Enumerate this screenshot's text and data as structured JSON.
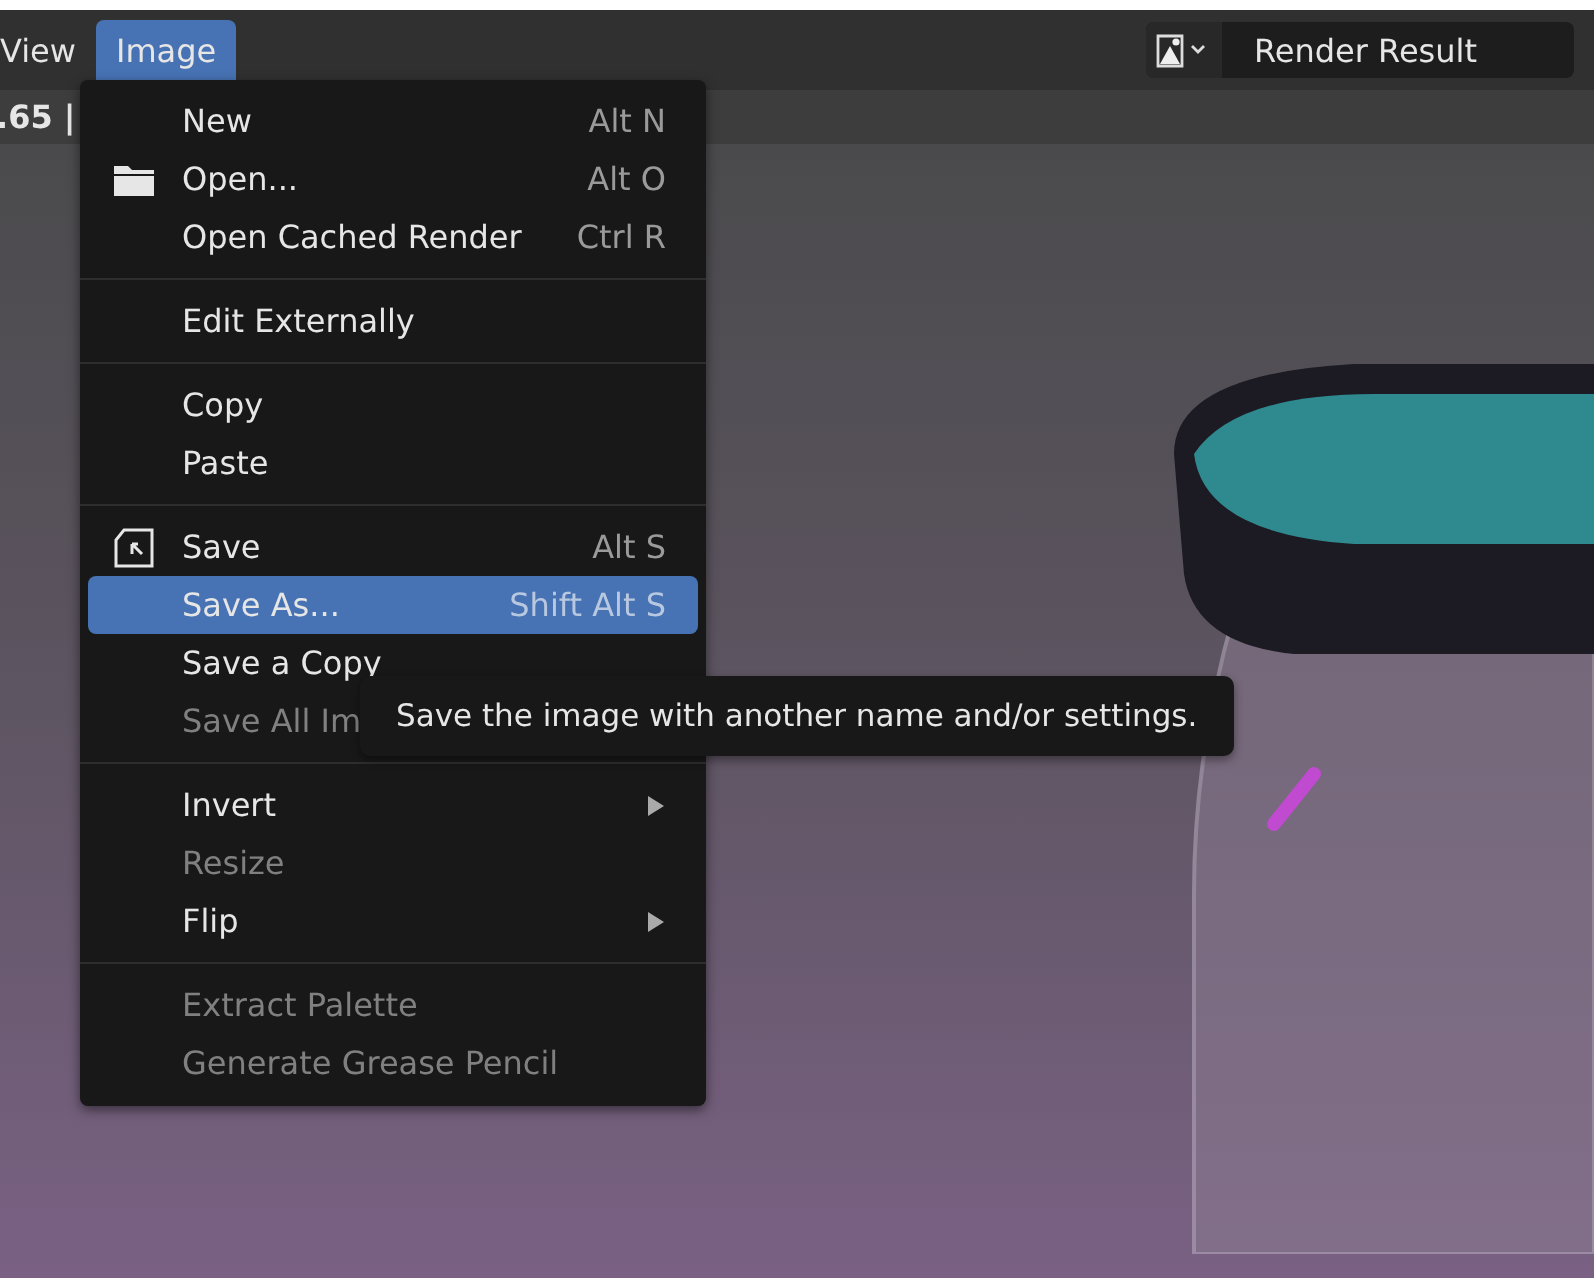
{
  "header": {
    "menus": [
      {
        "label": "View",
        "selected": false
      },
      {
        "label": "Image",
        "selected": true
      }
    ],
    "image_selector": {
      "label": "Render Result"
    }
  },
  "info_bar": {
    "text": ".65 |"
  },
  "image_menu": {
    "sections": [
      {
        "items": [
          {
            "label": "New",
            "shortcut": "Alt N",
            "kind": "plain",
            "disabled": false,
            "selected": false,
            "submenu": false
          },
          {
            "label": "Open...",
            "shortcut": "Alt O",
            "kind": "folder",
            "disabled": false,
            "selected": false,
            "submenu": false
          },
          {
            "label": "Open Cached Render",
            "shortcut": "Ctrl R",
            "kind": "plain",
            "disabled": false,
            "selected": false,
            "submenu": false
          }
        ]
      },
      {
        "items": [
          {
            "label": "Edit Externally",
            "kind": "plain",
            "disabled": false,
            "selected": false,
            "submenu": false
          }
        ]
      },
      {
        "items": [
          {
            "label": "Copy",
            "kind": "plain",
            "disabled": false,
            "selected": false,
            "submenu": false
          },
          {
            "label": "Paste",
            "kind": "plain",
            "disabled": false,
            "selected": false,
            "submenu": false
          }
        ]
      },
      {
        "items": [
          {
            "label": "Save",
            "shortcut": "Alt S",
            "kind": "save",
            "disabled": false,
            "selected": false,
            "submenu": false
          },
          {
            "label": "Save As...",
            "shortcut": "Shift Alt S",
            "kind": "plain",
            "disabled": false,
            "selected": true,
            "submenu": false
          },
          {
            "label": "Save a Copy",
            "kind": "plain",
            "disabled": false,
            "selected": false,
            "submenu": false
          },
          {
            "label": "Save All Im",
            "kind": "plain",
            "disabled": true,
            "selected": false,
            "submenu": false
          }
        ]
      },
      {
        "items": [
          {
            "label": "Invert",
            "kind": "plain",
            "disabled": false,
            "selected": false,
            "submenu": true
          },
          {
            "label": "Resize",
            "kind": "plain",
            "disabled": true,
            "selected": false,
            "submenu": false
          },
          {
            "label": "Flip",
            "kind": "plain",
            "disabled": false,
            "selected": false,
            "submenu": true
          }
        ]
      },
      {
        "items": [
          {
            "label": "Extract Palette",
            "kind": "plain",
            "disabled": true,
            "selected": false,
            "submenu": false
          },
          {
            "label": "Generate Grease Pencil",
            "kind": "plain",
            "disabled": true,
            "selected": false,
            "submenu": false
          }
        ]
      }
    ]
  },
  "tooltip": {
    "text": "Save the image with another name and/or settings."
  }
}
